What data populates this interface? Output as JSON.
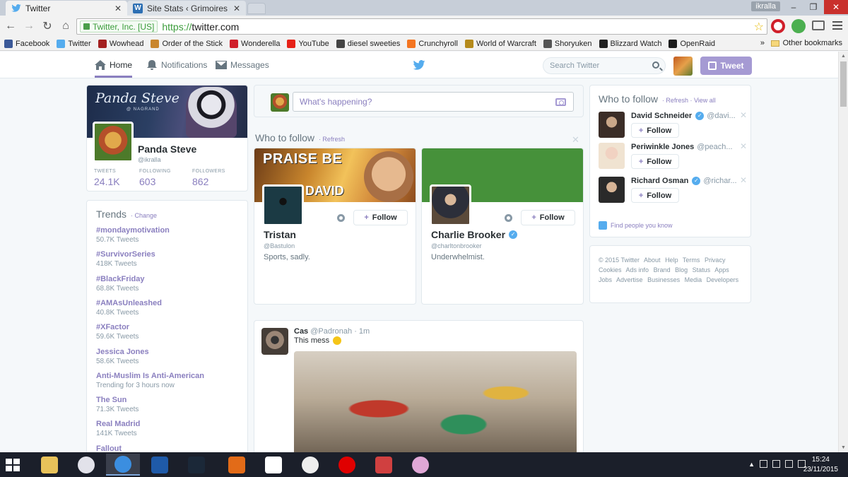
{
  "browser": {
    "tabs": [
      {
        "title": "Twitter",
        "close": "✕"
      },
      {
        "title": "Site Stats ‹ Grimoires of S",
        "close": "✕"
      }
    ],
    "profile_chip": "ikralla",
    "window_controls": {
      "minimize": "–",
      "maximize": "❐",
      "close": "✕"
    },
    "nav": {
      "back": "←",
      "forward": "→",
      "reload": "↻",
      "home": "⌂"
    },
    "ev_label": "Twitter, Inc. [US]",
    "url_scheme": "https://",
    "url_host": "twitter.com",
    "bookmark_star": "☆",
    "bookmarks": [
      {
        "label": "Facebook",
        "icon": "facebook-icon",
        "color": "#3b5998"
      },
      {
        "label": "Twitter",
        "icon": "twitter-icon",
        "color": "#55acee"
      },
      {
        "label": "Wowhead",
        "icon": "wowhead-icon",
        "color": "#a32020"
      },
      {
        "label": "Order of the Stick",
        "icon": "oots-icon",
        "color": "#c9862d"
      },
      {
        "label": "Wonderella",
        "icon": "wonderella-icon",
        "color": "#d0202b"
      },
      {
        "label": "YouTube",
        "icon": "youtube-icon",
        "color": "#e62117"
      },
      {
        "label": "diesel sweeties",
        "icon": "diesel-sweeties-icon",
        "color": "#444444"
      },
      {
        "label": "Crunchyroll",
        "icon": "crunchyroll-icon",
        "color": "#f47521"
      },
      {
        "label": "World of Warcraft",
        "icon": "wow-icon",
        "color": "#b58a1b"
      },
      {
        "label": "Shoryuken",
        "icon": "shoryuken-icon",
        "color": "#555555"
      },
      {
        "label": "Blizzard Watch",
        "icon": "blizzard-watch-icon",
        "color": "#222222"
      },
      {
        "label": "OpenRaid",
        "icon": "openraid-icon",
        "color": "#1b1b1b"
      }
    ],
    "bookmarks_more": "»",
    "other_bookmarks": "Other bookmarks"
  },
  "twitter": {
    "nav": {
      "home": "Home",
      "notifications": "Notifications",
      "messages": "Messages"
    },
    "search_placeholder": "Search Twitter",
    "tweet_button": "Tweet",
    "accent_color": "#8a7fbf",
    "profile": {
      "banner_title": "Panda Steve",
      "banner_subtitle": "@ NAGRAND",
      "name": "Panda Steve",
      "handle": "@ikralla",
      "stats": [
        {
          "label": "TWEETS",
          "value": "24.1K"
        },
        {
          "label": "FOLLOWING",
          "value": "603"
        },
        {
          "label": "FOLLOWERS",
          "value": "862"
        }
      ]
    },
    "trends": {
      "title": "Trends",
      "change": "· Change",
      "items": [
        {
          "name": "#mondaymotivation",
          "count": "50.7K Tweets"
        },
        {
          "name": "#SurvivorSeries",
          "count": "418K Tweets"
        },
        {
          "name": "#BlackFriday",
          "count": "68.8K Tweets"
        },
        {
          "name": "#AMAsUnleashed",
          "count": "40.8K Tweets"
        },
        {
          "name": "#XFactor",
          "count": "59.6K Tweets"
        },
        {
          "name": "Jessica Jones",
          "count": "58.6K Tweets"
        },
        {
          "name": "Anti-Muslim Is Anti-American",
          "count": "Trending for 3 hours now"
        },
        {
          "name": "The Sun",
          "count": "71.3K Tweets"
        },
        {
          "name": "Real Madrid",
          "count": "141K Tweets"
        },
        {
          "name": "Fallout",
          "count": ""
        }
      ]
    },
    "composer_placeholder": "What's happening?",
    "who_to_follow_main": {
      "title": "Who to follow",
      "refresh": "· Refresh",
      "dismiss": "✕",
      "cards": [
        {
          "banner_text_1": "PRAISE BE",
          "banner_text_2": "DAVID",
          "name": "Tristan",
          "handle": "@Bastulon",
          "bio": "Sports, sadly.",
          "follow": "Follow",
          "verified": false
        },
        {
          "banner_text_1": "",
          "banner_text_2": "",
          "name": "Charlie Brooker",
          "handle": "@charltonbrooker",
          "bio": "Underwhelmist.",
          "follow": "Follow",
          "verified": true
        }
      ]
    },
    "tweet": {
      "author": "Cas",
      "handle": "@Padronah",
      "time": "· 1m",
      "text": "This mess"
    },
    "who_to_follow_side": {
      "title": "Who to follow",
      "links": "· Refresh · View all",
      "items": [
        {
          "name": "David Schneider",
          "handle": "@davi...",
          "verified": true,
          "follow": "Follow"
        },
        {
          "name": "Periwinkle Jones",
          "handle": "@peach...",
          "verified": false,
          "follow": "Follow"
        },
        {
          "name": "Richard Osman",
          "handle": "@richar...",
          "verified": true,
          "follow": "Follow"
        }
      ],
      "find_people": "Find people you know"
    },
    "footer_links": [
      "© 2015 Twitter",
      "About",
      "Help",
      "Terms",
      "Privacy",
      "Cookies",
      "Ads info",
      "Brand",
      "Blog",
      "Status",
      "Apps",
      "Jobs",
      "Advertise",
      "Businesses",
      "Media",
      "Developers"
    ]
  },
  "taskbar": {
    "apps": [
      {
        "icon": "file-explorer-icon",
        "color": "#e8c25a"
      },
      {
        "icon": "itunes-icon",
        "color": "#e2e2ea"
      },
      {
        "icon": "chrome-icon",
        "color": "#3b8ee0"
      },
      {
        "icon": "battlenet-icon",
        "color": "#1f5aa8"
      },
      {
        "icon": "steam-icon",
        "color": "#1b2838"
      },
      {
        "icon": "hearthstone-icon",
        "color": "#e26b18"
      },
      {
        "icon": "cross-app-icon",
        "color": "#ffffff"
      },
      {
        "icon": "hd-app-icon",
        "color": "#eeeeee"
      },
      {
        "icon": "record-icon",
        "color": "#e00000"
      },
      {
        "icon": "tool-app-icon",
        "color": "#d04040"
      },
      {
        "icon": "itunes-icon-2",
        "color": "#e0a7d6"
      }
    ],
    "time": "15:24",
    "date": "23/11/2015"
  }
}
